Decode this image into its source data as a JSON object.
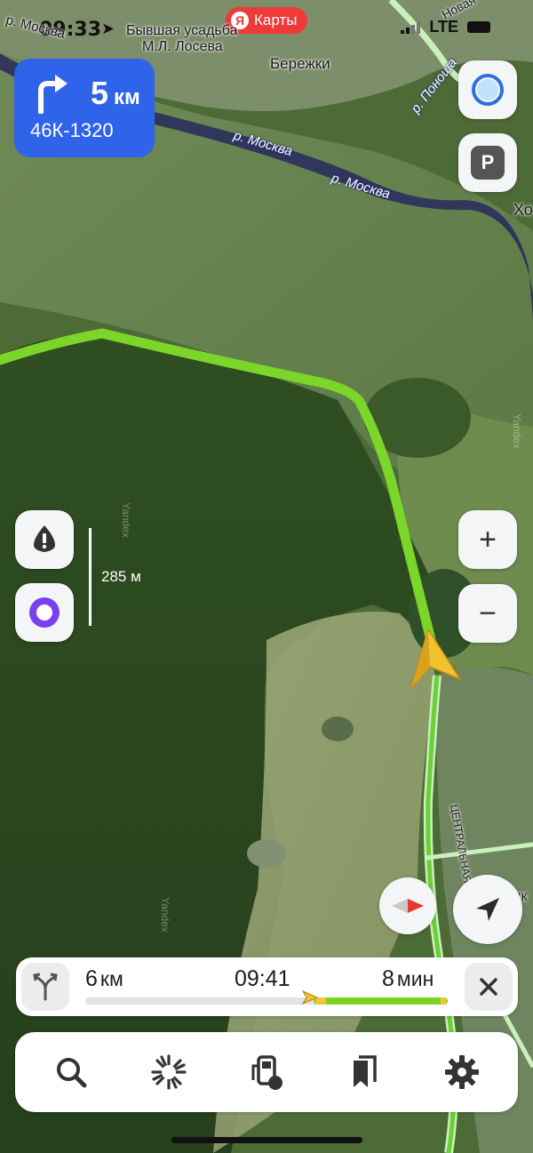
{
  "status_bar": {
    "time": "09:33",
    "carrier": "LTE"
  },
  "brand": {
    "logo_letter": "Я",
    "name": "Карты"
  },
  "map_labels": {
    "poi_1": "Бывшая усадьба",
    "poi_2": "М.Л. Лосева",
    "village_1": "Бережки",
    "river_1": "р. Москва",
    "river_2": "р. Москва",
    "river_3": "р. Москва",
    "river_4": "р. Поноша",
    "road_top": "Новая",
    "road_right": "ЦЕНТРАЛЬНАЯ",
    "edge_right_top": "Хо",
    "edge_right_bottom": "Ник",
    "watermark": "Yandex"
  },
  "maneuver": {
    "icon": "turn-right-icon",
    "distance": "5",
    "unit": "км",
    "road": "46К-1320"
  },
  "scale": {
    "label": "285 м"
  },
  "controls": {
    "alice_icon": "alice-icon",
    "parking_label": "P",
    "zoom_in": "+",
    "zoom_out": "−",
    "report_icon": "road-event-icon",
    "voice_icon": "alice-voice-icon",
    "compass_icon": "compass-icon",
    "locate_icon": "navigation-arrow-icon"
  },
  "route": {
    "distance": "6",
    "distance_unit": "км",
    "eta": "09:41",
    "duration": "8",
    "duration_unit": "мин",
    "progress": 0.63,
    "colors": {
      "done": "#e3e3e6",
      "free": "#7ed221",
      "slow": "#f4c531"
    }
  },
  "tabbar": {
    "items": [
      {
        "name": "search",
        "icon": "search-icon"
      },
      {
        "name": "discovery",
        "icon": "sparkle-icon"
      },
      {
        "name": "fuel",
        "icon": "fuel-icon"
      },
      {
        "name": "bookmarks",
        "icon": "bookmarks-icon"
      },
      {
        "name": "settings",
        "icon": "gear-icon"
      }
    ]
  },
  "colors": {
    "route_line": "#7cd62a",
    "maneuver_bg": "#2f63ea",
    "brand": "#ef3a3a",
    "cursor": "#f2c12e"
  }
}
